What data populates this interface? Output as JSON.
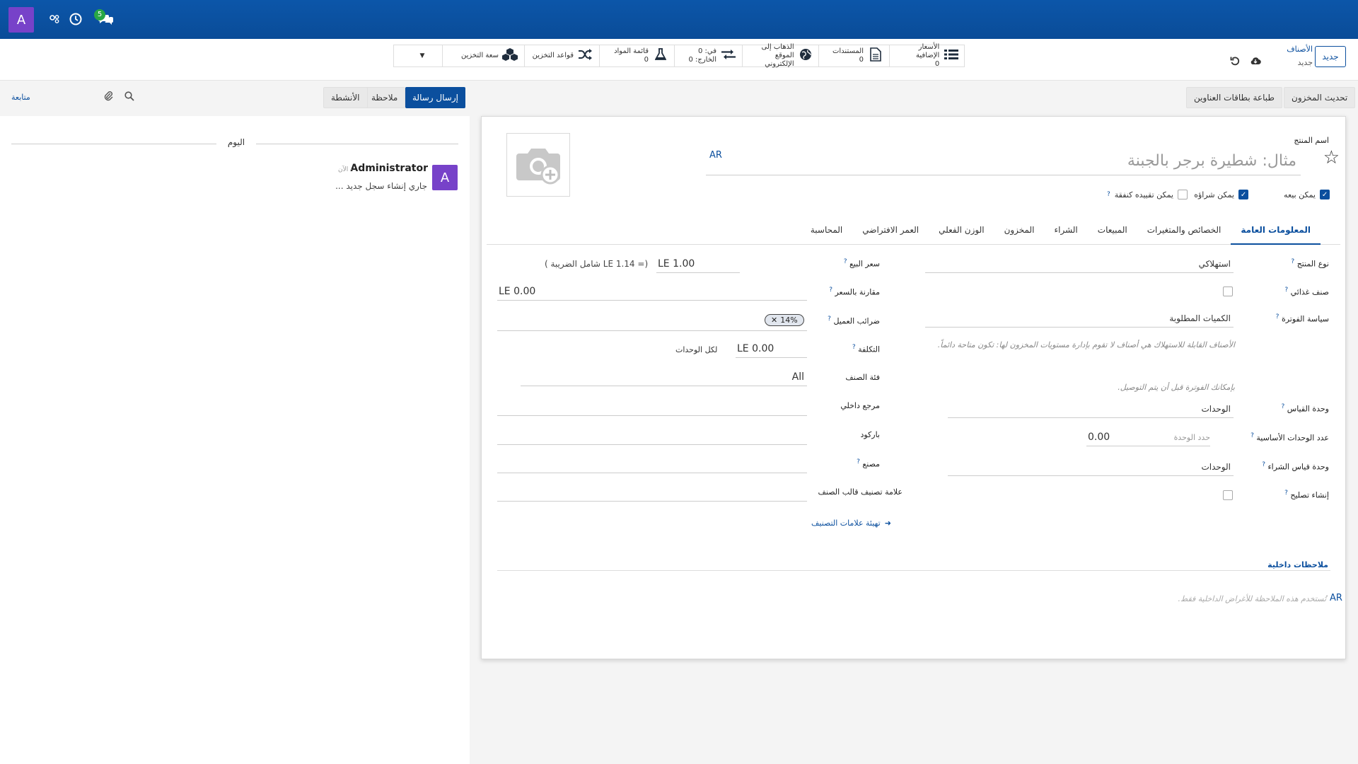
{
  "navbar": {
    "user_initial": "A",
    "message_count": "5"
  },
  "breadcrumb": {
    "parent": "الأصناف",
    "current": "جديد",
    "new_button": "جديد"
  },
  "smart_buttons": [
    {
      "icon": "list-icon",
      "label": "الأسعار الإضافية",
      "value": "0"
    },
    {
      "icon": "document-icon",
      "label": "المستندات",
      "value": "0"
    },
    {
      "icon": "globe-icon",
      "label": "الذهاب إلى الموقع الإلكتروني",
      "value": ""
    },
    {
      "icon": "transfer-icon",
      "label": "في: 0",
      "value": "الخارج: 0"
    },
    {
      "icon": "flask-icon",
      "label": "قائمة المواد",
      "value": "0"
    },
    {
      "icon": "shuffle-icon",
      "label": "قواعد التخزين",
      "value": ""
    },
    {
      "icon": "cubes-icon",
      "label": "سعة التخزين",
      "value": ""
    }
  ],
  "form_buttons": {
    "update_qty": "تحديث المخزون",
    "print_labels": "طباعة بطاقات العناوين"
  },
  "product": {
    "name_label": "اسم المنتج",
    "name_placeholder": "مثال: شطيرة برجر بالجبنة",
    "lang": "AR",
    "can_be_sold": "يمكن بيعه",
    "can_be_purchased": "يمكن شراؤه",
    "can_be_expensed": "يمكن تقييده كنفقة"
  },
  "tabs": [
    "المعلومات العامة",
    "الخصائص والمتغيرات",
    "المبيعات",
    "الشراء",
    "المخزون",
    "الوزن الفعلي",
    "العمر الافتراضي",
    "المحاسبة"
  ],
  "general": {
    "product_type_label": "نوع المنتج",
    "product_type_value": "استهلاكي",
    "is_food_label": "صنف غذائي",
    "invoice_policy_label": "سياسة الفوترة",
    "invoice_policy_value": "الكميات المطلوبة",
    "consumable_note": "الأصناف القابلة للاستهلاك هي أصناف لا تقوم بإدارة مستويات المخزون لها: تكون متاحة دائماً.",
    "invoice_note": "بإمكانك الفوترة قبل أن يتم التوصيل.",
    "uom_label": "وحدة القياس",
    "uom_value": "الوحدات",
    "base_units_label": "عدد الوحدات الأساسية",
    "base_units_value": "0.00",
    "base_units_placeholder": "حدد الوحدة",
    "purchase_uom_label": "وحدة قياس الشراء",
    "purchase_uom_value": "الوحدات",
    "create_repair_label": "إنشاء تصليح",
    "sale_price_label": "سعر البيع",
    "sale_price_value": "LE 1.00",
    "sale_price_tax_note": "(= LE 1.14 شامل الضريبة )",
    "compare_price_label": "مقارنة بالسعر",
    "compare_price_value": "LE 0.00",
    "customer_tax_label": "ضرائب العميل",
    "customer_tax_tag": "14%",
    "cost_label": "التكلفة",
    "cost_value": "LE 0.00",
    "cost_suffix": "لكل الوحدات",
    "category_label": "فئة الصنف",
    "category_value": "All",
    "internal_ref_label": "مرجع داخلي",
    "barcode_label": "باركود",
    "manufacturer_label": "مصنع",
    "template_tag_label": "علامة تصنيف قالب الصنف",
    "configure_tags_link": "تهيئة علامات التصنيف",
    "internal_notes_title": "ملاحظات داخلية",
    "internal_notes_lang": "AR",
    "internal_notes_placeholder": "تُستخدم هذه الملاحظة للأغراض الداخلية فقط."
  },
  "chatter": {
    "send_message": "إرسال رسالة",
    "log_note": "ملاحظة",
    "activities": "الأنشطة",
    "follow": "متابعة",
    "today": "اليوم",
    "author": "Administrator",
    "time": "- الآن",
    "avatar_initial": "A",
    "message": "جاري إنشاء سجل جديد ..."
  }
}
